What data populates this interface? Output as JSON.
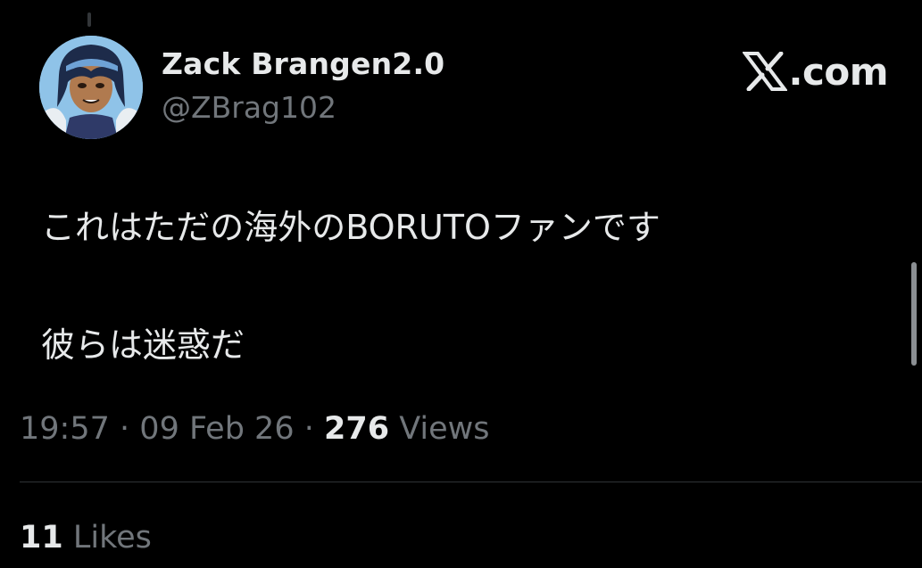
{
  "author": {
    "display_name": "Zack Brangen2.0",
    "handle": "@ZBrag102",
    "avatar_icon": "anime-character-avatar"
  },
  "brand": {
    "icon": "x-logo-icon",
    "text": ".com"
  },
  "tweet": {
    "lines": [
      "これはただの海外のBORUTOファンです",
      "彼らは迷惑だ"
    ]
  },
  "meta": {
    "time": "19:57",
    "separator": "·",
    "date": "09 Feb 26",
    "views_count": "276",
    "views_label": "Views"
  },
  "engagement": {
    "likes_count": "11",
    "likes_label": "Likes"
  },
  "colors": {
    "background": "#000000",
    "primary_text": "#e7e9ea",
    "secondary_text": "#71767b",
    "divider": "#2f3336"
  }
}
